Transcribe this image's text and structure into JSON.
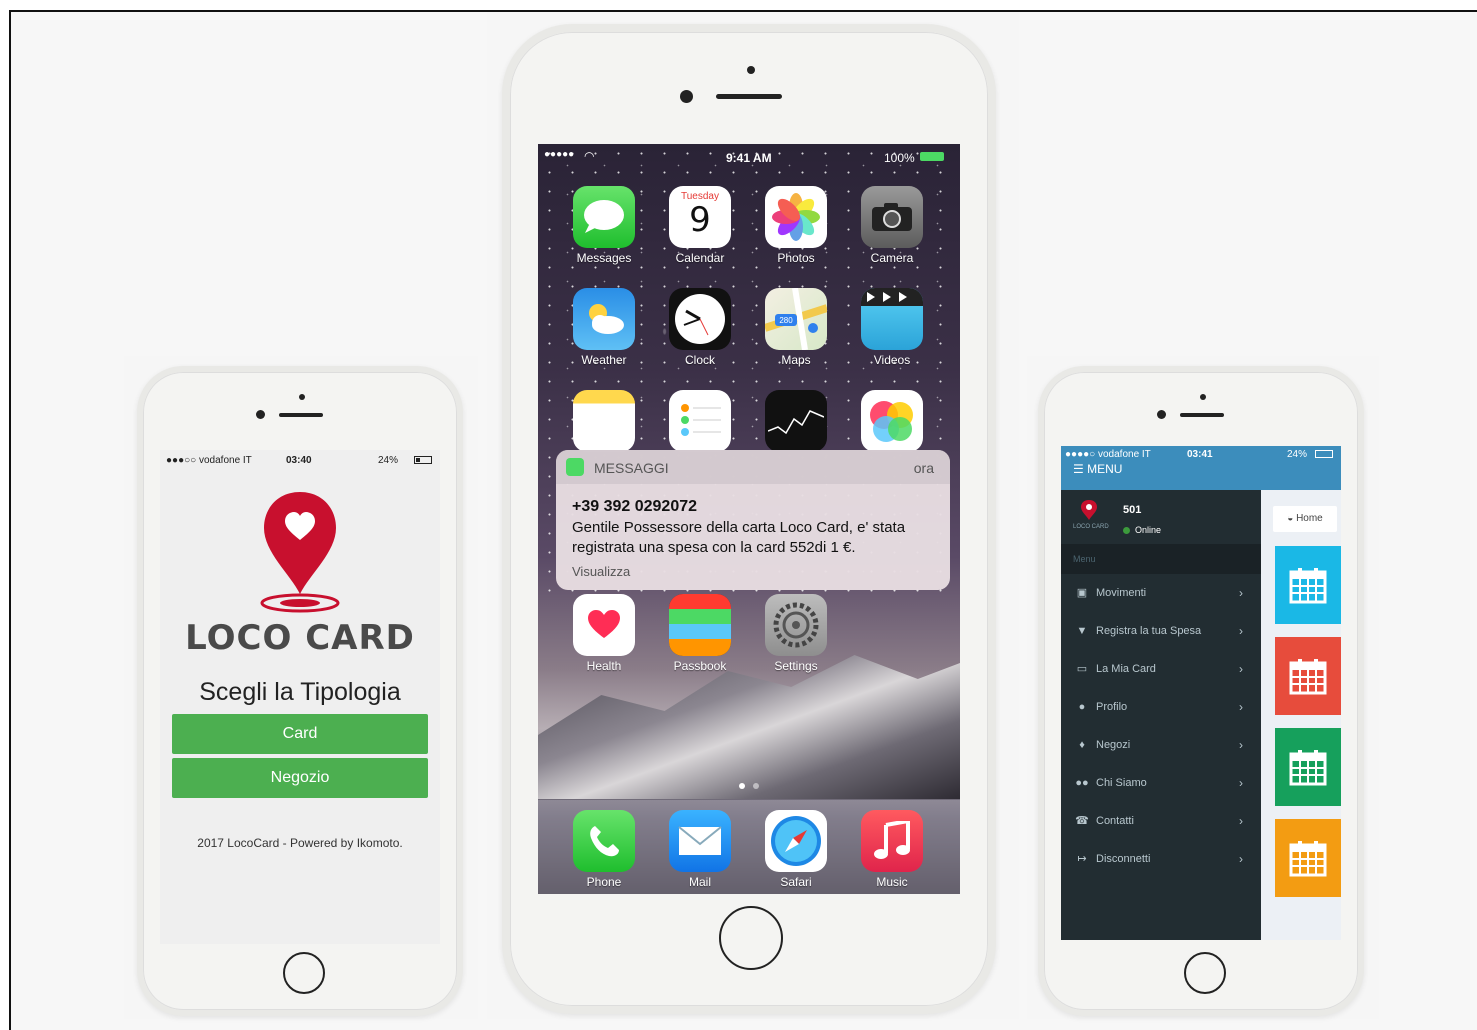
{
  "left_phone": {
    "status": {
      "carrier": "●●●○○ vodafone IT",
      "time": "03:40",
      "battery": "24%"
    },
    "logo_text": "LOCO CARD",
    "heading": "Scegli la Tipologia",
    "buttons": [
      "Card",
      "Negozio"
    ],
    "footer": "2017 LocoCard - Powered by Ikomoto.",
    "accent_color": "#4caf50",
    "logo_color": "#c8102e"
  },
  "middle_phone": {
    "status": {
      "signal": "●●●●●",
      "time": "9:41 AM",
      "battery": "100%"
    },
    "apps_row1": [
      {
        "label": "Messages",
        "icon": "messages-icon"
      },
      {
        "label": "Calendar",
        "icon": "calendar-icon",
        "day_name": "Tuesday",
        "day_number": "9"
      },
      {
        "label": "Photos",
        "icon": "photos-icon"
      },
      {
        "label": "Camera",
        "icon": "camera-icon"
      }
    ],
    "apps_row2": [
      {
        "label": "Weather",
        "icon": "weather-icon"
      },
      {
        "label": "Clock",
        "icon": "clock-icon"
      },
      {
        "label": "Maps",
        "icon": "maps-icon",
        "badge": "280"
      },
      {
        "label": "Videos",
        "icon": "videos-icon"
      }
    ],
    "apps_row4": [
      {
        "label": "Health",
        "icon": "health-icon"
      },
      {
        "label": "Passbook",
        "icon": "passbook-icon"
      },
      {
        "label": "Settings",
        "icon": "settings-icon"
      }
    ],
    "dock": [
      {
        "label": "Phone",
        "icon": "phone-icon"
      },
      {
        "label": "Mail",
        "icon": "mail-icon"
      },
      {
        "label": "Safari",
        "icon": "safari-icon"
      },
      {
        "label": "Music",
        "icon": "music-icon"
      }
    ],
    "notification": {
      "app": "MESSAGGI",
      "time": "ora",
      "sender": "+39 392 0292072",
      "body": "Gentile Possessore della carta Loco Card, e' stata registrata una spesa con la card 552di 1 €.",
      "action": "Visualizza"
    }
  },
  "right_phone": {
    "status": {
      "carrier": "●●●●○ vodafone IT",
      "time": "03:41",
      "battery": "24%"
    },
    "menu_label": "☰ MENU",
    "user": {
      "id": "501",
      "status": "Online",
      "logo_caption": "LOCO CARD"
    },
    "section_header": "Menu",
    "menu_items": [
      {
        "label": "Movimenti",
        "icon": "money-icon"
      },
      {
        "label": "Registra la tua Spesa",
        "icon": "cart-icon"
      },
      {
        "label": "La Mia Card",
        "icon": "credit-card-icon"
      },
      {
        "label": "Profilo",
        "icon": "user-icon"
      },
      {
        "label": "Negozi",
        "icon": "map-marker-icon"
      },
      {
        "label": "Chi Siamo",
        "icon": "users-icon"
      },
      {
        "label": "Contatti",
        "icon": "phone-icon"
      },
      {
        "label": "Disconnetti",
        "icon": "sign-out-icon"
      }
    ],
    "breadcrumb": "Home",
    "tile_colors": [
      "#1ab8e6",
      "#e74c3c",
      "#16a05c",
      "#f39c12"
    ]
  }
}
